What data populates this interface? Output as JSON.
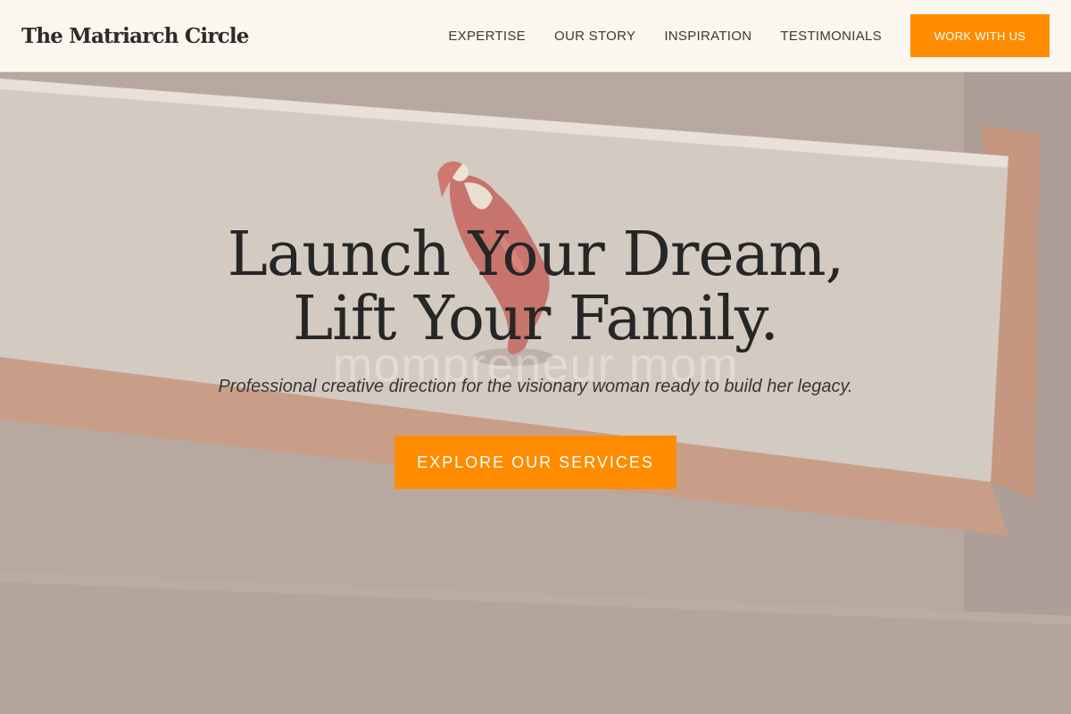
{
  "header": {
    "brand": "The Matriarch Circle",
    "nav": [
      {
        "label": "EXPERTISE"
      },
      {
        "label": "OUR STORY"
      },
      {
        "label": "INSPIRATION"
      },
      {
        "label": "TESTIMONIALS"
      }
    ],
    "cta_label": "WORK WITH US"
  },
  "hero": {
    "title_line1": "Launch Your Dream,",
    "title_line2": "Lift Your Family.",
    "watermark": "mompreneur mom",
    "subtitle": "Professional creative direction for the visionary woman ready to build her legacy.",
    "cta_label": "EXPLORE OUR SERVICES",
    "image_alt": "Red and white figurine on a wooden ledge"
  },
  "colors": {
    "accent": "#ff8c00",
    "header_bg": "#fbf6ee",
    "text_dark": "#262626"
  }
}
